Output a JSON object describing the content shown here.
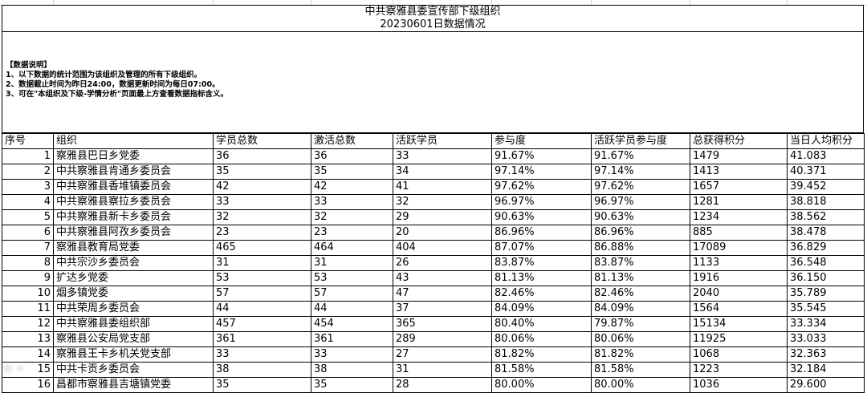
{
  "title": "中共察雅县委宣传部下级组织",
  "subtitle": "20230601日数据情况",
  "notes": {
    "heading": "【数据说明】",
    "lines": [
      "1、以下数据的统计范围为该组织及管理的所有下级组织。",
      "2、数据截止时间为昨日24:00，数据更新时间为每日07:00。",
      "3、可在\"本组织及下级-学情分析\"页面最上方查看数据指标含义。"
    ]
  },
  "table": {
    "headers": [
      "序号",
      "组织",
      "学员总数",
      "激活总数",
      "活跃学员",
      "参与度",
      "活跃学员参与度",
      "总获得积分",
      "当日人均积分"
    ],
    "rows": [
      [
        "1",
        "察雅县巴日乡党委",
        "36",
        "36",
        "33",
        "91.67%",
        "91.67%",
        "1479",
        "41.083"
      ],
      [
        "2",
        "中共察雅县肯通乡委员会",
        "35",
        "35",
        "34",
        "97.14%",
        "97.14%",
        "1413",
        "40.371"
      ],
      [
        "3",
        "中共察雅县香堆镇委员会",
        "42",
        "42",
        "41",
        "97.62%",
        "97.62%",
        "1657",
        "39.452"
      ],
      [
        "4",
        "中共察雅县察拉乡委员会",
        "33",
        "33",
        "32",
        "96.97%",
        "96.97%",
        "1281",
        "38.818"
      ],
      [
        "5",
        "中共察雅县新卡乡委员会",
        "32",
        "32",
        "29",
        "90.63%",
        "90.63%",
        "1234",
        "38.562"
      ],
      [
        "6",
        "中共察雅县阿孜乡委员会",
        "23",
        "23",
        "20",
        "86.96%",
        "86.96%",
        "885",
        "38.478"
      ],
      [
        "7",
        "察雅县教育局党委",
        "465",
        "464",
        "404",
        "87.07%",
        "86.88%",
        "17089",
        "36.829"
      ],
      [
        "8",
        "中共宗沙乡委员会",
        "31",
        "31",
        "26",
        "83.87%",
        "83.87%",
        "1133",
        "36.548"
      ],
      [
        "9",
        "扩达乡党委",
        "53",
        "53",
        "43",
        "81.13%",
        "81.13%",
        "1916",
        "36.150"
      ],
      [
        "10",
        "烟多镇党委",
        "57",
        "57",
        "47",
        "82.46%",
        "82.46%",
        "2040",
        "35.789"
      ],
      [
        "11",
        "中共荣周乡委员会",
        "44",
        "44",
        "37",
        "84.09%",
        "84.09%",
        "1564",
        "35.545"
      ],
      [
        "12",
        "中共察雅县委组织部",
        "457",
        "454",
        "365",
        "80.40%",
        "79.87%",
        "15134",
        "33.334"
      ],
      [
        "13",
        "察雅县公安局党支部",
        "361",
        "361",
        "289",
        "80.06%",
        "80.06%",
        "11925",
        "33.033"
      ],
      [
        "14",
        "察雅县王卡乡机关党支部",
        "33",
        "33",
        "27",
        "81.82%",
        "81.82%",
        "1068",
        "32.363"
      ],
      [
        "15",
        "中共卡贡乡委员会",
        "38",
        "38",
        "31",
        "81.58%",
        "81.58%",
        "1223",
        "32.184"
      ],
      [
        "16",
        "昌都市察雅县吉塘镇党委",
        "35",
        "35",
        "28",
        "80.00%",
        "80.00%",
        "1036",
        "29.600"
      ]
    ]
  }
}
